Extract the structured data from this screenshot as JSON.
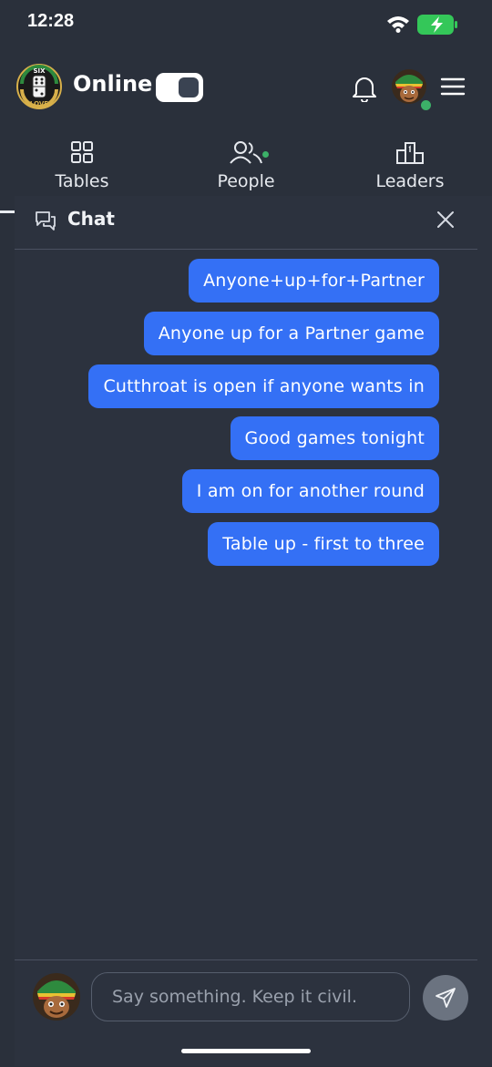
{
  "status_bar": {
    "time": "12:28"
  },
  "header": {
    "logo_text_top": "SIX",
    "logo_text_bottom": "LOVE",
    "status_label": "Online",
    "toggle_on": true
  },
  "nav": {
    "tabs": [
      {
        "label": "Tables",
        "icon": "grid-icon"
      },
      {
        "label": "People",
        "icon": "people-icon"
      },
      {
        "label": "Leaders",
        "icon": "leaderboard-icon"
      }
    ]
  },
  "chat": {
    "title": "Chat",
    "messages": [
      "Anyone+up+for+Partner",
      "Anyone up for a Partner game",
      "Cutthroat is open if anyone wants in",
      "Good games tonight",
      "I am on for another round",
      "Table up - first to three"
    ],
    "input_placeholder": "Say something. Keep it civil."
  },
  "colors": {
    "background": "#2a303b",
    "bubble": "#3470f5",
    "online": "#3cb068",
    "battery": "#34c759"
  }
}
